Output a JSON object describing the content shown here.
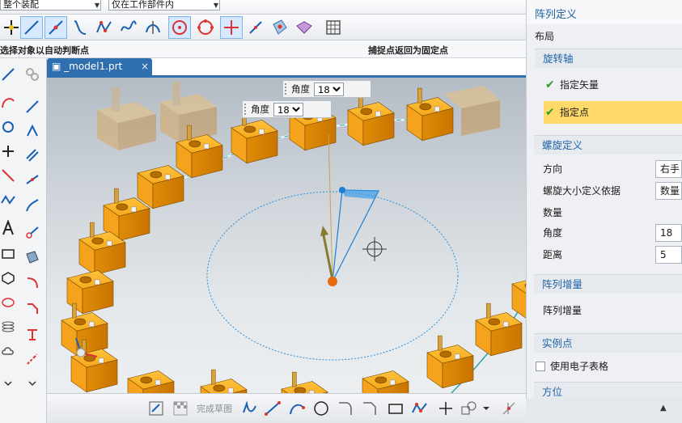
{
  "toolbar": {
    "filter_combo": "整个装配",
    "scope_combo": "仅在工作部件内",
    "hint_left": "选择对象以自动判断点",
    "hint_right": "捕捉点返回为固定点"
  },
  "tab": {
    "name": "_model1.prt",
    "close": "×"
  },
  "viewport": {
    "angle_field_1": {
      "label": "角度",
      "value": "18"
    },
    "angle_field_2": {
      "label": "角度",
      "value": "18"
    }
  },
  "bottom_toolbar": {
    "finish_sketch_label": "完成草图"
  },
  "dialog": {
    "title": "阵列定义",
    "layout_label": "布局",
    "sections": {
      "rotation_axis": "旋转轴",
      "helix_def": "螺旋定义",
      "pattern_increment": "阵列增量",
      "instance_point": "实例点",
      "orientation": "方位"
    },
    "specify_vector": "指定矢量",
    "specify_point": "指定点",
    "direction_label": "方向",
    "direction_value": "右手",
    "size_basis_label": "螺旋大小定义依据",
    "size_basis_value": "数量，",
    "count_label": "数量",
    "angle_label": "角度",
    "angle_value": "18",
    "distance_label": "距离",
    "distance_value": "5",
    "increment_label": "阵列增量",
    "use_spreadsheet_label": "使用电子表格",
    "use_spreadsheet_checked": false
  },
  "colors": {
    "accent": "#2f6fae",
    "block": "#f0a21a",
    "highlight": "#ffd96a"
  }
}
